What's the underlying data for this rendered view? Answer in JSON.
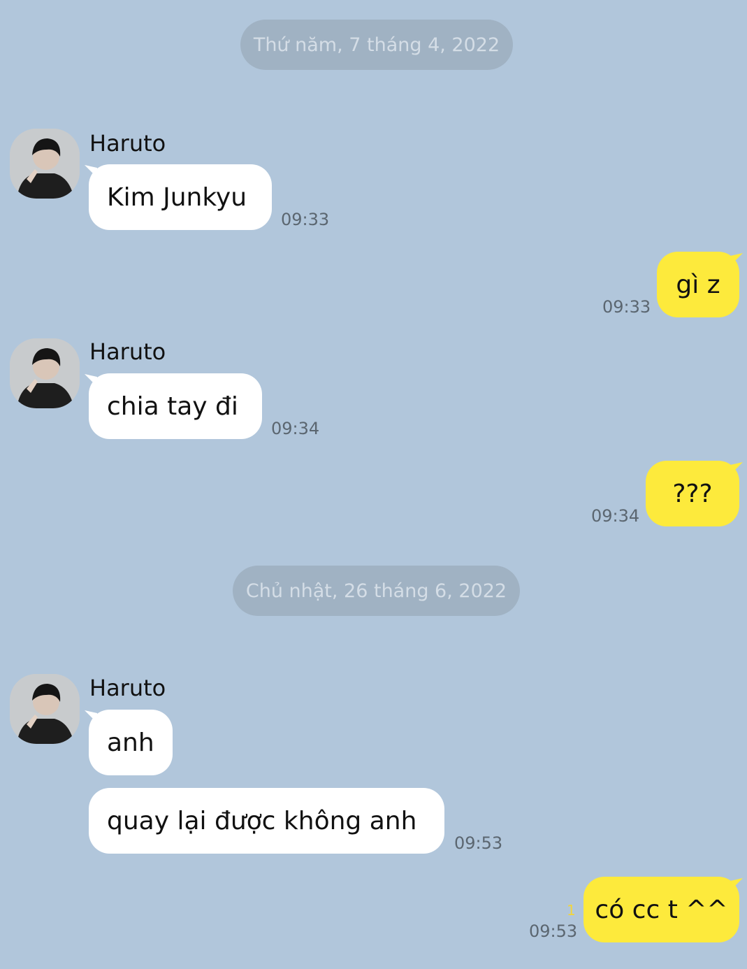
{
  "dates": [
    "Thứ năm, 7 tháng 4, 2022",
    "Chủ nhật, 26 tháng 6, 2022"
  ],
  "contact": {
    "name": "Haruto",
    "avatar_icon": "profile-photo"
  },
  "messages": [
    {
      "from": "Haruto",
      "text": "Kim Junkyu",
      "time": "09:33"
    },
    {
      "from": "me",
      "text": "gì z",
      "time": "09:33"
    },
    {
      "from": "Haruto",
      "text": "chia tay đi",
      "time": "09:34"
    },
    {
      "from": "me",
      "text": "???",
      "time": "09:34"
    },
    {
      "from": "Haruto",
      "text": "anh",
      "time": ""
    },
    {
      "from": "Haruto",
      "text": "quay lại được không anh",
      "time": "09:53"
    },
    {
      "from": "me",
      "text": "có cc t ^^",
      "time": "09:53",
      "unread": "1"
    }
  ],
  "colors": {
    "background": "#b1c6db",
    "incoming_bubble": "#ffffff",
    "outgoing_bubble": "#fdea3c",
    "date_pill": "#a0b2c3",
    "unread_count": "#f2d53a"
  }
}
